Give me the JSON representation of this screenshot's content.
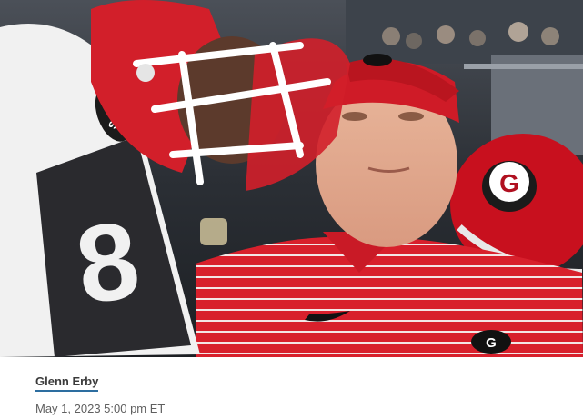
{
  "photo": {
    "subject": "photo"
  },
  "byline": {
    "author": "Glenn Erby",
    "date": "May 1, 2023 5:00 pm ET"
  },
  "colors": {
    "link_underline": "#2d6ea0",
    "text_primary": "#3b3b3b",
    "text_secondary": "#5f5f5f",
    "georgia_red": "#d21f2a"
  }
}
